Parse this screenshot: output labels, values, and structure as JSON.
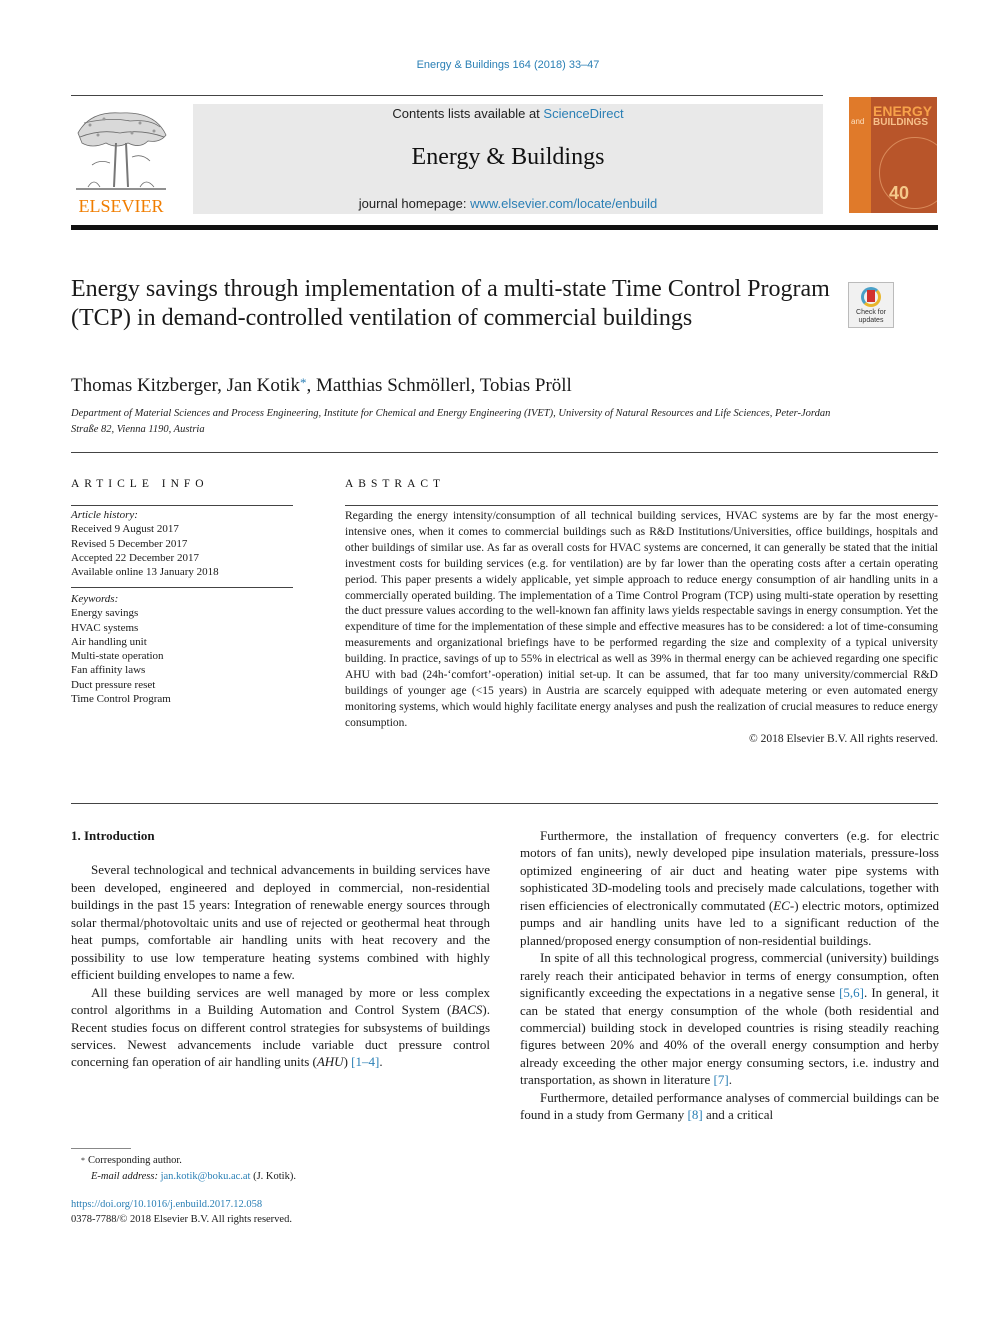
{
  "running_head": "Energy & Buildings 164 (2018) 33–47",
  "masthead": {
    "publisher_logo_text": "ELSEVIER",
    "contents_prefix": "Contents lists available at ",
    "contents_link": "ScienceDirect",
    "journal_name": "Energy & Buildings",
    "homepage_prefix": "journal homepage: ",
    "homepage_link": "www.elsevier.com/locate/enbuild",
    "cover": {
      "title_line1": "ENERGY",
      "title_line2": "BUILDINGS",
      "and": "and",
      "anniversary": "40"
    },
    "colors": {
      "elsevier_orange": "#f07d00",
      "link_blue": "#2a7fb5",
      "banner_grey": "#e9e9e9"
    }
  },
  "article": {
    "title": "Energy savings through implementation of a multi-state Time Control Program (TCP) in demand-controlled ventilation of commercial buildings",
    "crossmark_label": "Check for updates",
    "authors": [
      {
        "name": "Thomas Kitzberger",
        "sep": ", "
      },
      {
        "name": "Jan Kotik",
        "mark": "*",
        "sep": ", "
      },
      {
        "name": "Matthias Schmöllerl",
        "sep": ", "
      },
      {
        "name": "Tobias Pröll",
        "sep": ""
      }
    ],
    "affiliation": "Department of Material Sciences and Process Engineering, Institute for Chemical and Energy Engineering (IVET), University of Natural Resources and Life Sciences, Peter-Jordan Straße 82, Vienna 1190, Austria"
  },
  "article_info": {
    "heading": "ARTICLE INFO",
    "history_label": "Article history:",
    "history": [
      "Received 9 August 2017",
      "Revised 5 December 2017",
      "Accepted 22 December 2017",
      "Available online 13 January 2018"
    ],
    "keywords_label": "Keywords:",
    "keywords": [
      "Energy savings",
      "HVAC systems",
      "Air handling unit",
      "Multi-state operation",
      "Fan affinity laws",
      "Duct pressure reset",
      "Time Control Program"
    ]
  },
  "abstract": {
    "heading": "ABSTRACT",
    "text": "Regarding the energy intensity/consumption of all technical building services, HVAC systems are by far the most energy-intensive ones, when it comes to commercial buildings such as R&D Institutions/Universities, office buildings, hospitals and other buildings of similar use. As far as overall costs for HVAC systems are concerned, it can generally be stated that the initial investment costs for building services (e.g. for ventilation) are by far lower than the operating costs after a certain operating period. This paper presents a widely applicable, yet simple approach to reduce energy consumption of air handling units in a commercially operated building. The implementation of a Time Control Program (TCP) using multi-state operation by resetting the duct pressure values according to the well-known fan affinity laws yields respectable savings in energy consumption. Yet the expenditure of time for the implementation of these simple and effective measures has to be considered: a lot of time-consuming measurements and organizational briefings have to be performed regarding the size and complexity of a typical university building. In practice, savings of up to 55% in electrical as well as 39% in thermal energy can be achieved regarding one specific AHU with bad (24h-‘comfort’-operation) initial set-up. It can be assumed, that far too many university/commercial R&D buildings of younger age (<15 years) in Austria are scarcely equipped with adequate metering or even automated energy monitoring systems, which would highly facilitate energy analyses and push the realization of crucial measures to reduce energy consumption.",
    "copyright": "© 2018 Elsevier B.V. All rights reserved."
  },
  "body": {
    "section_heading": "1. Introduction",
    "left_paragraphs": [
      {
        "text": "Several technological and technical advancements in building services have been developed, engineered and deployed in commercial, non-residential buildings in the past 15 years: Integration of renewable energy sources through solar thermal/photovoltaic units and use of rejected or geothermal heat through heat pumps, comfortable air handling units with heat recovery and the possibility to use low temperature heating systems combined with highly efficient building envelopes to name a few."
      },
      {
        "before": "All these building services are well managed by more or less complex control algorithms in a Building Automation and Control System (",
        "em1": "BACS",
        "middle": "). Recent studies focus on different control strategies for subsystems of buildings services. Newest advancements include variable duct pressure control concerning fan operation of air handling units (",
        "em2": "AHU",
        "after_em": ") ",
        "ref": "[1–4]",
        "end": "."
      }
    ],
    "right_paragraphs": [
      {
        "before": "Furthermore, the installation of frequency converters (e.g. for electric motors of fan units), newly developed pipe insulation materials, pressure-loss optimized engineering of air duct and heating water pipe systems with sophisticated 3D-modeling tools and precisely made calculations, together with risen efficiencies of electronically commutated (",
        "em": "EC-",
        "after": ") electric motors, optimized pumps and air handling units have led to a significant reduction of the planned/proposed energy consumption of non-residential buildings."
      },
      {
        "before": "In spite of all this technological progress, commercial (university) buildings rarely reach their anticipated behavior in terms of energy consumption, often significantly exceeding the expectations in a negative sense ",
        "ref1": "[5,6]",
        "middle": ". In general, it can be stated that energy consumption of the whole (both residential and commercial) building stock in developed countries is rising steadily reaching figures between 20% and 40% of the overall energy consumption and herby already exceeding the other major energy consuming sectors, i.e. industry and transportation, as shown in literature ",
        "ref2": "[7]",
        "end": "."
      },
      {
        "before": "Furthermore, detailed performance analyses of commercial buildings can be found in a study from Germany ",
        "ref": "[8]",
        "after": " and a critical"
      }
    ]
  },
  "footnotes": {
    "mark": "*",
    "corresponding": "Corresponding author.",
    "email_label": "E-mail address: ",
    "email": "jan.kotik@boku.ac.at",
    "email_suffix": " (J. Kotik).",
    "doi": "https://doi.org/10.1016/j.enbuild.2017.12.058",
    "issn_copyright": "0378-7788/© 2018 Elsevier B.V. All rights reserved."
  }
}
